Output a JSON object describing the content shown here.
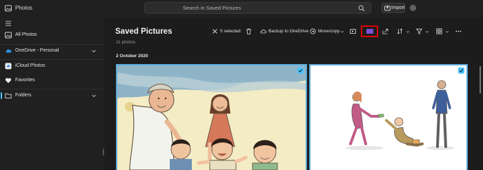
{
  "app": {
    "title": "Photos"
  },
  "search": {
    "placeholder": "Search in Saved Pictures"
  },
  "header": {
    "import_label": "Import"
  },
  "sidebar": {
    "items": [
      {
        "label": "All Photos"
      },
      {
        "label": "OneDrive - Personal"
      },
      {
        "label": "iCloud Photos"
      },
      {
        "label": "Favorites"
      },
      {
        "label": "Folders"
      }
    ]
  },
  "main": {
    "title": "Saved Pictures",
    "subtitle": "11 photos",
    "date_group": "2 October 2020"
  },
  "toolbar": {
    "selected_label": "5 selected",
    "backup_label": "Backup to OneDrive",
    "move_label": "Move/copy"
  },
  "colors": {
    "accent": "#4cc2ff",
    "highlight": "#e00000",
    "slideshow": "#7d4ed8"
  },
  "icons": [
    "photos-icon",
    "search-icon",
    "import-icon",
    "gear-icon",
    "hamburger-icon",
    "image-icon",
    "cloud-icon",
    "icloud-icon",
    "heart-icon",
    "folder-icon",
    "close-icon",
    "trash-icon",
    "backup-icon",
    "move-icon",
    "slideshow-icon",
    "share-icon",
    "sort-icon",
    "filter-icon",
    "view-icon",
    "more-icon"
  ]
}
